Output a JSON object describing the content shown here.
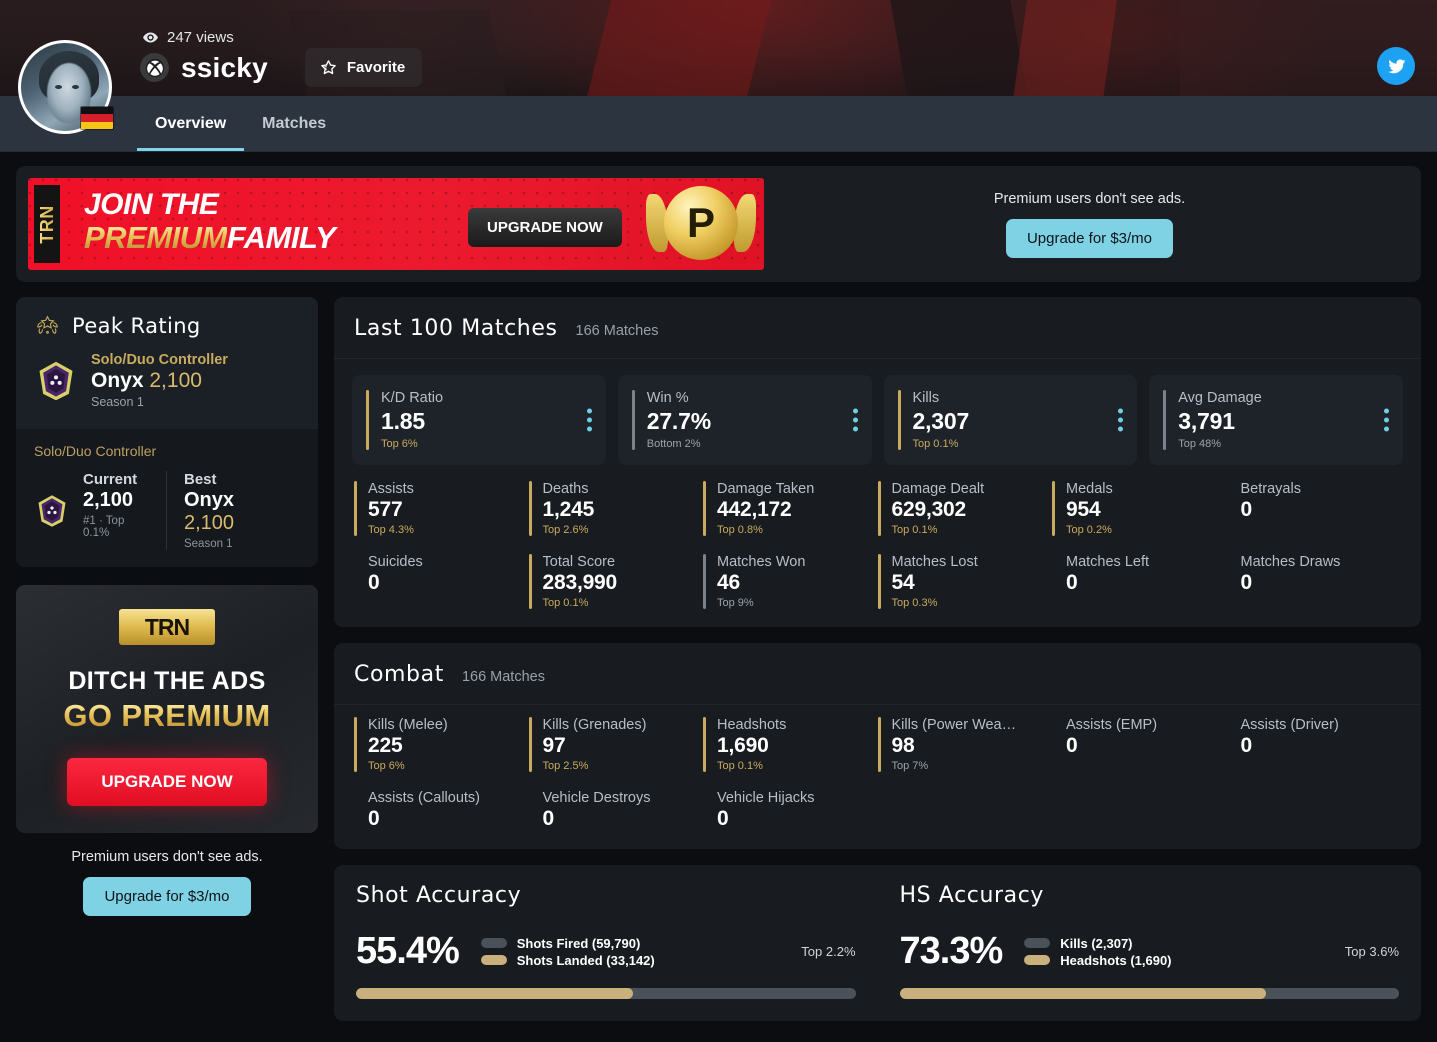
{
  "header": {
    "views": "247 views",
    "eye_icon": "eye-icon",
    "platform_icon": "xbox-icon",
    "gamertag": "ssicky",
    "favorite_label": "Favorite",
    "favorite_icon": "star-icon",
    "twitter_icon": "twitter-icon",
    "avatar_icon": "avatar",
    "flag_icon": "germany-flag-icon",
    "tabs": [
      {
        "label": "Overview",
        "active": true
      },
      {
        "label": "Matches",
        "active": false
      }
    ]
  },
  "ad_strip": {
    "trn_tag": "TRN",
    "line1": "JOIN THE",
    "line2_gold": "PREMIUM",
    "line2_white": "FAMILY",
    "cta": "UPGRADE NOW",
    "coin_letter": "P",
    "note": "Premium users don't see ads.",
    "upgrade_label": "Upgrade for $3/mo"
  },
  "side_ad": {
    "logo": "TRN",
    "line1": "DITCH THE ADS",
    "line2": "GO PREMIUM",
    "cta": "UPGRADE NOW",
    "note": "Premium users don't see ads.",
    "upgrade_label": "Upgrade for $3/mo"
  },
  "peak_rating": {
    "icon": "wreath-icon",
    "title": "Peak Rating",
    "rank_icon": "onyx-rank-icon",
    "playlist": "Solo/Duo Controller",
    "rank_name": "Onyx",
    "rank_value": "2,100",
    "season": "Season 1",
    "footer": {
      "playlist": "Solo/Duo Controller",
      "rank_icon": "onyx-rank-icon",
      "current_label": "Current",
      "current_value": "2,100",
      "current_sub": "#1 · Top 0.1%",
      "best_label": "Best",
      "best_rank": "Onyx",
      "best_value": "2,100",
      "best_sub": "Season 1"
    }
  },
  "last_100": {
    "title": "Last 100 Matches",
    "count": "166 Matches",
    "featured": [
      {
        "label": "K/D Ratio",
        "value": "1.85",
        "top": "Top 6%",
        "top_color": "#c9ab5e",
        "accent": "#c9ab5e"
      },
      {
        "label": "Win %",
        "value": "27.7%",
        "top": "Bottom 2%",
        "top_color": "#9aa3ac",
        "accent": "#7b828b"
      },
      {
        "label": "Kills",
        "value": "2,307",
        "top": "Top 0.1%",
        "top_color": "#c9ab5e",
        "accent": "#c9ab5e"
      },
      {
        "label": "Avg Damage",
        "value": "3,791",
        "top": "Top 48%",
        "top_color": "#9aa3ac",
        "accent": "#7b828b"
      }
    ],
    "grid": [
      [
        {
          "label": "Assists",
          "value": "577",
          "top": "Top 4.3%",
          "top_color": "#c9ab5e",
          "accent": "#c9ab5e"
        },
        {
          "label": "Deaths",
          "value": "1,245",
          "top": "Top 2.6%",
          "top_color": "#c9ab5e",
          "accent": "#c9ab5e"
        },
        {
          "label": "Damage Taken",
          "value": "442,172",
          "top": "Top 0.8%",
          "top_color": "#c9ab5e",
          "accent": "#c9ab5e"
        },
        {
          "label": "Damage Dealt",
          "value": "629,302",
          "top": "Top 0.1%",
          "top_color": "#c9ab5e",
          "accent": "#c9ab5e"
        },
        {
          "label": "Medals",
          "value": "954",
          "top": "Top 0.2%",
          "top_color": "#c9ab5e",
          "accent": "#c9ab5e"
        },
        {
          "label": "Betrayals",
          "value": "0",
          "top": "",
          "top_color": "",
          "accent": ""
        }
      ],
      [
        {
          "label": "Suicides",
          "value": "0",
          "top": "",
          "top_color": "",
          "accent": ""
        },
        {
          "label": "Total Score",
          "value": "283,990",
          "top": "Top 0.1%",
          "top_color": "#c9ab5e",
          "accent": "#c9ab5e"
        },
        {
          "label": "Matches Won",
          "value": "46",
          "top": "Top 9%",
          "top_color": "#9aa3ac",
          "accent": "#7b828b"
        },
        {
          "label": "Matches Lost",
          "value": "54",
          "top": "Top 0.3%",
          "top_color": "#c9ab5e",
          "accent": "#c9ab5e"
        },
        {
          "label": "Matches Left",
          "value": "0",
          "top": "",
          "top_color": "",
          "accent": ""
        },
        {
          "label": "Matches Draws",
          "value": "0",
          "top": "",
          "top_color": "",
          "accent": ""
        }
      ]
    ]
  },
  "combat": {
    "title": "Combat",
    "count": "166 Matches",
    "grid": [
      [
        {
          "label": "Kills (Melee)",
          "value": "225",
          "top": "Top 6%",
          "top_color": "#c9ab5e",
          "accent": "#c9ab5e"
        },
        {
          "label": "Kills (Grenades)",
          "value": "97",
          "top": "Top 2.5%",
          "top_color": "#c9ab5e",
          "accent": "#c9ab5e"
        },
        {
          "label": "Headshots",
          "value": "1,690",
          "top": "Top 0.1%",
          "top_color": "#c9ab5e",
          "accent": "#c9ab5e"
        },
        {
          "label": "Kills (Power Wea…",
          "value": "98",
          "top": "Top 7%",
          "top_color": "#9aa3ac",
          "accent": "#c9ab5e"
        },
        {
          "label": "Assists (EMP)",
          "value": "0",
          "top": "",
          "top_color": "",
          "accent": ""
        },
        {
          "label": "Assists (Driver)",
          "value": "0",
          "top": "",
          "top_color": "",
          "accent": ""
        }
      ],
      [
        {
          "label": "Assists (Callouts)",
          "value": "0",
          "top": "",
          "top_color": "",
          "accent": ""
        },
        {
          "label": "Vehicle Destroys",
          "value": "0",
          "top": "",
          "top_color": "",
          "accent": ""
        },
        {
          "label": "Vehicle Hijacks",
          "value": "0",
          "top": "",
          "top_color": "",
          "accent": ""
        },
        {
          "label": "",
          "value": "",
          "top": "",
          "top_color": "",
          "accent": ""
        },
        {
          "label": "",
          "value": "",
          "top": "",
          "top_color": "",
          "accent": ""
        },
        {
          "label": "",
          "value": "",
          "top": "",
          "top_color": "",
          "accent": ""
        }
      ]
    ]
  },
  "accuracy": {
    "shot": {
      "title": "Shot Accuracy",
      "percent": "55.4%",
      "legend_total": "Shots Fired (59,790)",
      "legend_hit": "Shots Landed (33,142)",
      "top": "Top 2.2%",
      "fill_pct": 55.4
    },
    "hs": {
      "title": "HS Accuracy",
      "percent": "73.3%",
      "legend_total": "Kills (2,307)",
      "legend_hit": "Headshots (1,690)",
      "top": "Top 3.6%",
      "fill_pct": 73.3
    }
  },
  "colors": {
    "accent_gold": "#c9ab5e",
    "accent_cyan": "#7fd4e8",
    "bar_fill": "#c9b07c",
    "bar_track": "#4b5159"
  }
}
